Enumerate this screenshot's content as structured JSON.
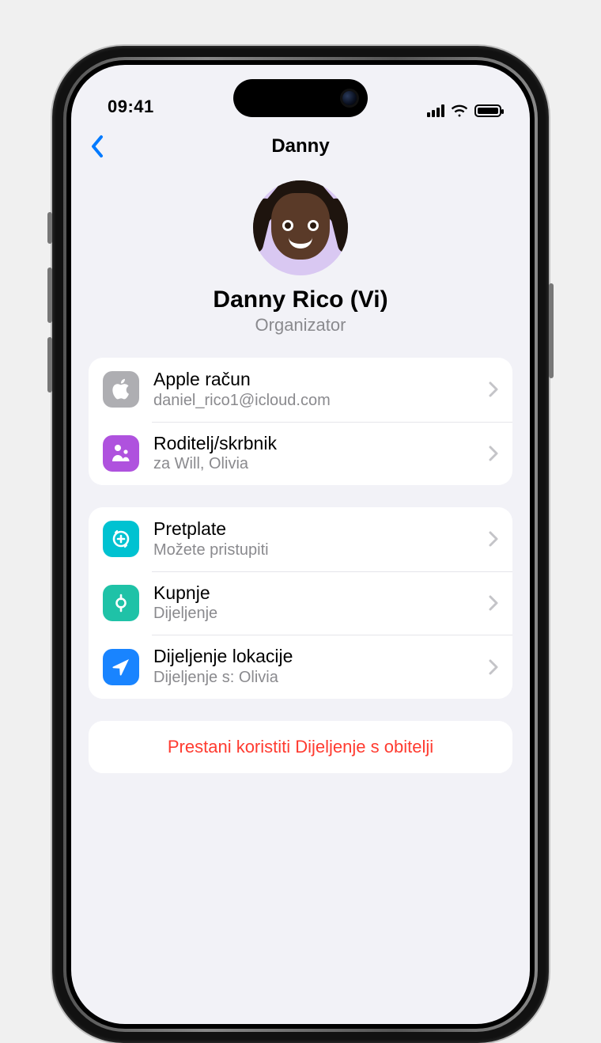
{
  "status": {
    "time": "09:41"
  },
  "nav": {
    "title": "Danny"
  },
  "profile": {
    "name": "Danny Rico (Vi)",
    "role": "Organizator"
  },
  "group1": [
    {
      "icon": "apple-icon",
      "title": "Apple račun",
      "subtitle": "daniel_rico1@icloud.com"
    },
    {
      "icon": "guardian-icon",
      "title": "Roditelj/skrbnik",
      "subtitle": "za Will, Olivia"
    }
  ],
  "group2": [
    {
      "icon": "subscriptions-icon",
      "title": "Pretplate",
      "subtitle": "Možete pristupiti"
    },
    {
      "icon": "purchases-icon",
      "title": "Kupnje",
      "subtitle": "Dijeljenje"
    },
    {
      "icon": "location-icon",
      "title": "Dijeljenje lokacije",
      "subtitle": "Dijeljenje s: Olivia"
    }
  ],
  "actions": {
    "stop_sharing": "Prestani koristiti Dijeljenje s obitelji"
  },
  "colors": {
    "accent": "#007aff",
    "destructive": "#ff3b30",
    "secondary_text": "#8a8a8e"
  }
}
